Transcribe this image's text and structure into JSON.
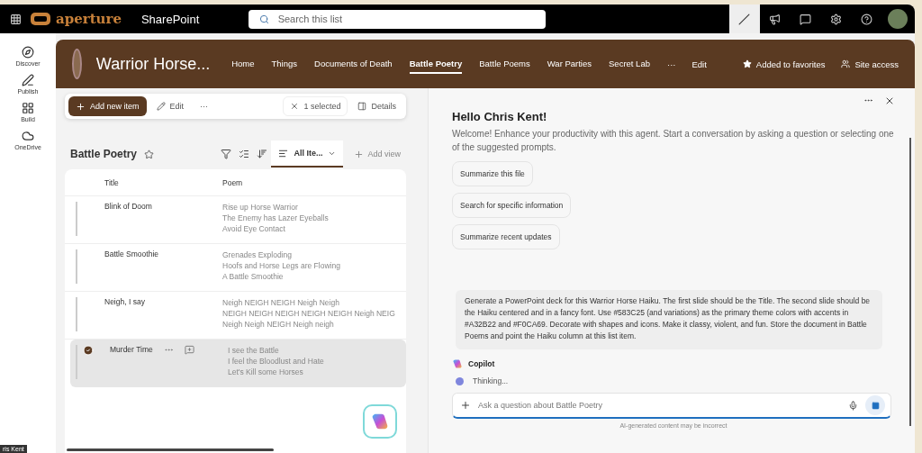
{
  "topbar": {
    "brand": "aperture",
    "app": "SharePoint",
    "search": {
      "placeholder": "Search this list"
    }
  },
  "rail": [
    {
      "label": "Discover",
      "kind": "discover"
    },
    {
      "label": "Publish",
      "kind": "publish"
    },
    {
      "label": "Build",
      "kind": "build"
    },
    {
      "label": "OneDrive",
      "kind": "onedrive"
    }
  ],
  "site": {
    "title": "Warrior Horse...",
    "nav": [
      {
        "label": "Home",
        "selected": false
      },
      {
        "label": "Things",
        "selected": false
      },
      {
        "label": "Documents of Death",
        "selected": false
      },
      {
        "label": "Battle Poetry",
        "selected": true
      },
      {
        "label": "Battle Poems",
        "selected": false
      },
      {
        "label": "War Parties",
        "selected": false
      },
      {
        "label": "Secret Lab",
        "selected": false
      }
    ],
    "more": "···",
    "edit": "Edit",
    "favorite": "Added to favorites",
    "access": "Site access"
  },
  "commandbar": {
    "add": "Add new item",
    "edit": "Edit",
    "more": "···",
    "selection": "1 selected",
    "details": "Details"
  },
  "list": {
    "title": "Battle Poetry",
    "view": "All Ite...",
    "add_view": "Add view",
    "columns": [
      "Title",
      "Poem"
    ],
    "rows": [
      {
        "title": "Blink of Doom",
        "poem": [
          "Rise up Horse Warrior",
          "The Enemy has Lazer Eyeballs",
          "Avoid Eye Contact"
        ],
        "selected": false
      },
      {
        "title": "Battle Smoothie",
        "poem": [
          "Grenades Exploding",
          "Hoofs and Horse Legs are Flowing",
          "A Battle Smoothie"
        ],
        "selected": false
      },
      {
        "title": "Neigh, I say",
        "poem": [
          "Neigh NEIGH NEIGH Neigh Neigh",
          "NEIGH NEIGH NEIGH NEIGH NEIGH Neigh NEIG",
          "Neigh Neigh NEIGH Neigh neigh"
        ],
        "selected": false
      },
      {
        "title": "Murder Time",
        "poem": [
          "I see the Battle",
          "I feel the Bloodlust and Hate",
          "Let's Kill some Horses"
        ],
        "selected": true
      }
    ]
  },
  "copilot": {
    "greeting": "Hello Chris Kent!",
    "welcome": "Welcome! Enhance your productivity with this agent. Start a conversation by asking a question or selecting one of the suggested prompts.",
    "prompts": [
      "Summarize this file",
      "Search for specific information",
      "Summarize recent updates"
    ],
    "message": "Generate a PowerPoint deck for this Warrior Horse Haiku. The first slide should be the Title. The second slide should be the Haiku centered and in a fancy font. Use #583C25 (and variations) as the primary theme colors with accents in #A32B22 and #F0CA69. Decorate with shapes and icons. Make it classy, violent, and fun. Store the document in Battle Poems and point the Haiku column at this list item.",
    "sender": "Copilot",
    "status": "Thinking...",
    "input": {
      "placeholder": "Ask a question about Battle Poetry"
    },
    "disclaimer": "AI-generated content may be incorrect"
  },
  "taskbar_fragment": "ris Kent"
}
